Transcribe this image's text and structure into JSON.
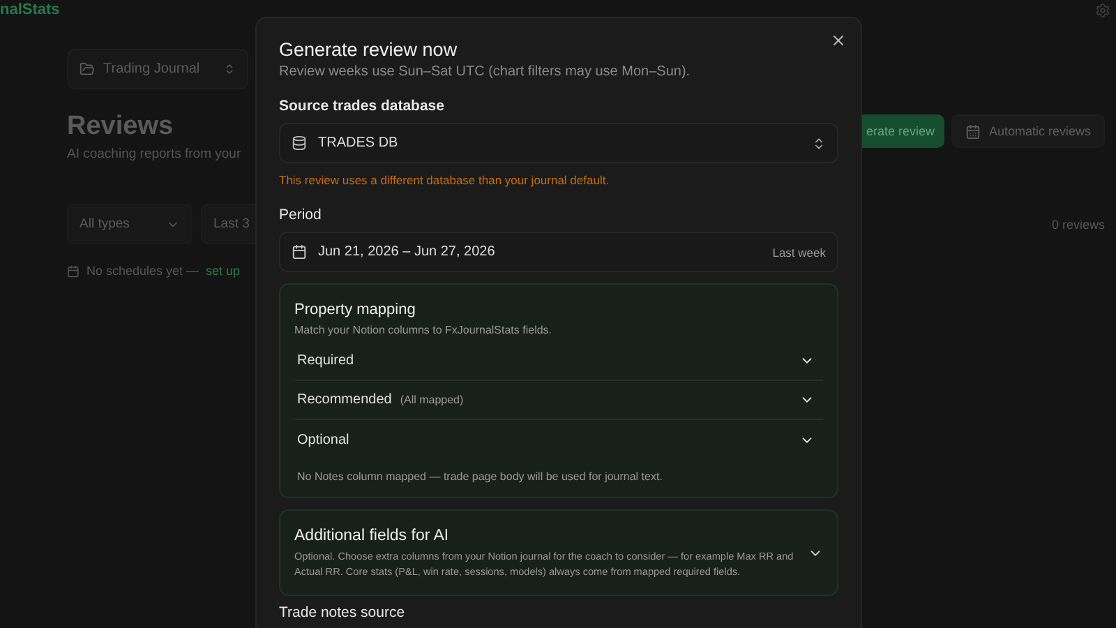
{
  "app": {
    "logo": "nalStats"
  },
  "journal_selector": {
    "value": "Trading Journal"
  },
  "page": {
    "title": "Reviews",
    "subtitle": "AI coaching reports from your"
  },
  "actions": [
    {
      "label": "erate review",
      "kind": "primary"
    },
    {
      "label": "Automatic reviews",
      "kind": "secondary"
    }
  ],
  "filters": [
    {
      "value": "All types"
    },
    {
      "value": "Last 3"
    }
  ],
  "review_count": "0 reviews",
  "schedules_notice": {
    "text": "No schedules yet —",
    "link": "set up"
  },
  "dialog": {
    "title": "Generate review now",
    "subtitle": "Review weeks use Sun–Sat UTC (chart filters may use Mon–Sun).",
    "source_label": "Source trades database",
    "database": "TRADES DB",
    "warning": "This review uses a different database than your journal default.",
    "period_label": "Period",
    "period": "Jun 21, 2026 – Jun 27, 2026",
    "period_hint": "Last week",
    "mapping": {
      "title": "Property mapping",
      "subtitle": "Match your Notion columns to FxJournalStats fields.",
      "sections": [
        {
          "label": "Required",
          "expanded": false
        },
        {
          "label": "Recommended",
          "note": "(All mapped)",
          "expanded": false
        },
        {
          "label": "Optional",
          "expanded": false
        }
      ],
      "note": "No Notes column mapped — trade page body will be used for journal text."
    },
    "additional": {
      "title": "Additional fields for AI",
      "description": "Optional. Choose extra columns from your Notion journal for the coach to consider — for example Max RR and Actual RR. Core stats (P&L, win rate, sessions, models) always come from mapped required fields.",
      "expanded": false
    },
    "trade_notes_label": "Trade notes source"
  }
}
